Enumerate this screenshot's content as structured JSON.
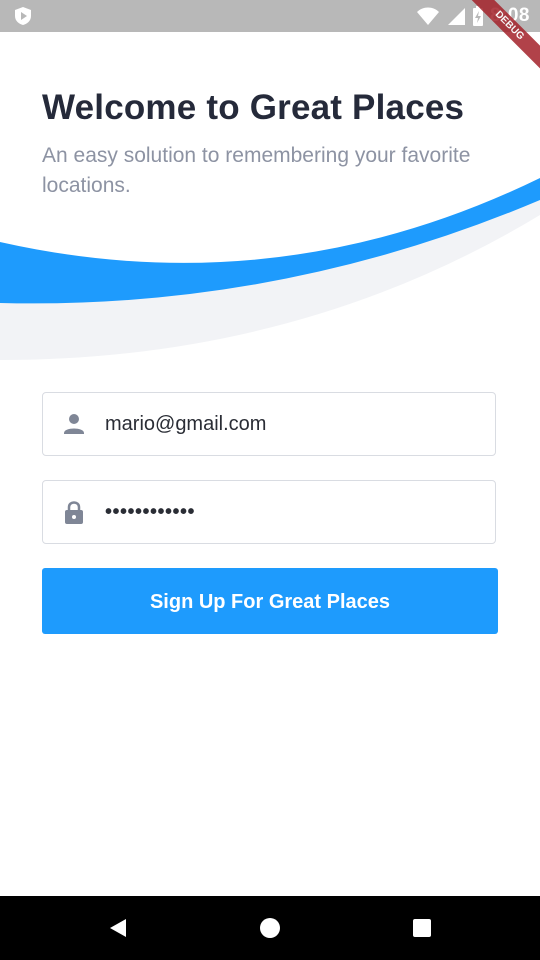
{
  "status_bar": {
    "time": "8:08"
  },
  "debug_banner": {
    "label": "DEBUG"
  },
  "header": {
    "title": "Welcome to Great Places",
    "subtitle": "An easy solution to remembering your favorite locations."
  },
  "form": {
    "email": {
      "icon": "person-icon",
      "value": "mario@gmail.com"
    },
    "password": {
      "icon": "lock-icon",
      "value": "••••••••••••"
    },
    "submit_label": "Sign Up For Great Places"
  },
  "nav_bar": {
    "back_icon": "back-triangle-icon",
    "home_icon": "home-circle-icon",
    "recents_icon": "recents-square-icon"
  },
  "colors": {
    "accent": "#1e9bfd",
    "title": "#252a3a",
    "subtitle": "#8d93a3",
    "wave_gray": "#f2f3f6",
    "status_bar": "#b8b8b8"
  }
}
